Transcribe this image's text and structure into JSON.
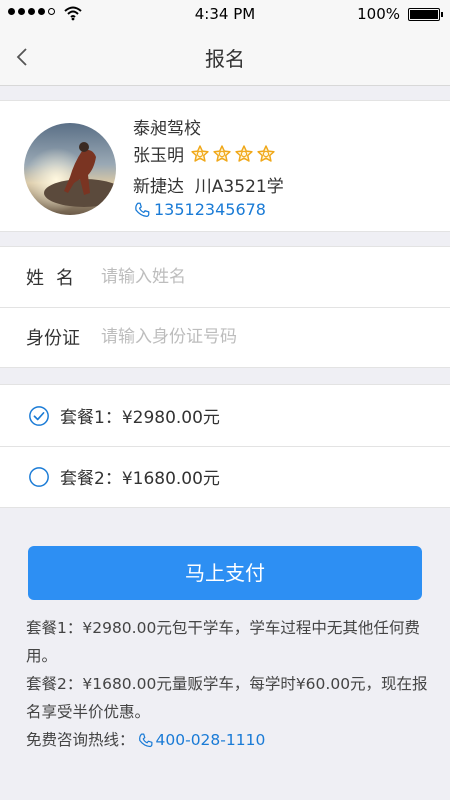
{
  "status_bar": {
    "time": "4:34 PM",
    "battery": "100%",
    "battery_level": 1.0,
    "signal_bars": 4,
    "signal_max": 5
  },
  "nav": {
    "back_icon": "chevron-left-icon",
    "title": "报名"
  },
  "coach": {
    "school": "泰昶驾校",
    "name": "张玉明",
    "rating": 4,
    "car": "新捷达  川A3521学",
    "phone": "13512345678",
    "phone_icon": "phone-icon"
  },
  "form": {
    "name_label": "姓名",
    "name_placeholder": "请输入姓名",
    "name_value": "",
    "id_label": "身份证",
    "id_placeholder": "请输入身份证号码",
    "id_value": ""
  },
  "packages": [
    {
      "label": "套餐1：¥2980.00元",
      "selected": true
    },
    {
      "label": "套餐2：¥1680.00元",
      "selected": false
    }
  ],
  "pay_button": "马上支付",
  "notes": {
    "line1": "套餐1：¥2980.00元包干学车，学车过程中无其他任何费用。",
    "line2": "套餐2：¥1680.00元量贩学车，每学时¥60.00元，现在报名享受半价优惠。",
    "hotline_label": "免费咨询热线：",
    "hotline": "400-028-1110"
  },
  "colors": {
    "accent": "#2d8ff3",
    "link": "#1a7bd6",
    "star": "#f0a81a",
    "background": "#efeff4"
  }
}
